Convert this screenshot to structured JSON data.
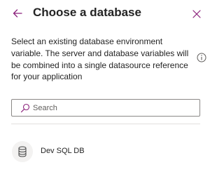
{
  "header": {
    "title": "Choose a database",
    "back_icon": "arrow-left-icon",
    "close_icon": "close-icon"
  },
  "description": "Select an existing database environment variable. The server and database variables will be combined into a single datasource reference for your application",
  "info_icon": "info-icon",
  "search": {
    "placeholder": "Search",
    "value": "",
    "icon": "search-icon"
  },
  "databases": [
    {
      "label": "Dev SQL DB",
      "icon": "database-icon"
    }
  ],
  "colors": {
    "accent": "#8a1f7a",
    "text": "#242424",
    "border": "#8a8886",
    "divider": "#e1dfdd",
    "icon_bg": "#f3f2f1"
  }
}
